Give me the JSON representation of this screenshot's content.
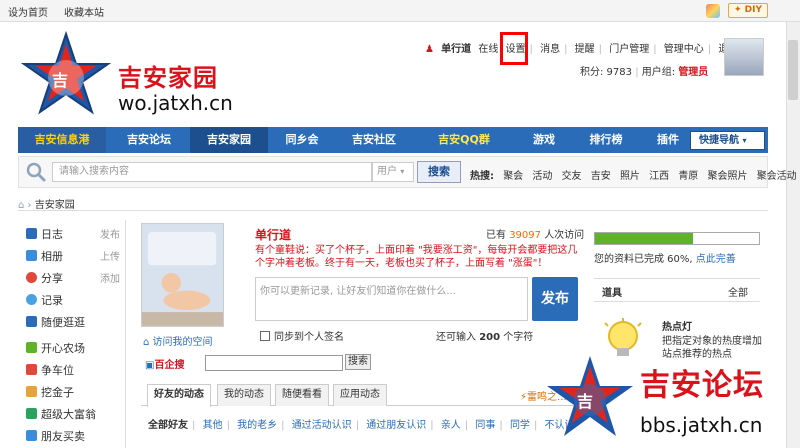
{
  "topbar": {
    "links": [
      "设为首页",
      "收藏本站"
    ],
    "diy_label": "DIY"
  },
  "header": {
    "site_title": "吉安家园",
    "site_url": "wo.jatxh.cn"
  },
  "user_nav": {
    "username": "单行道",
    "status": "在线",
    "links": [
      "设置",
      "消息",
      "提醒",
      "门户管理",
      "管理中心",
      "退出"
    ],
    "points_label": "积分: 9783",
    "group_label": "用户组:",
    "group_value": "管理员"
  },
  "main_nav": {
    "items": [
      "吉安信息港",
      "吉安论坛",
      "吉安家园",
      "同乡会",
      "吉安社区",
      "吉安QQ群",
      "游戏",
      "排行榜",
      "插件"
    ],
    "quick_nav": "快捷导航"
  },
  "search": {
    "placeholder": "请输入搜索内容",
    "type_label": "用户",
    "button": "搜索",
    "hot_label": "热搜:",
    "hot_words": [
      "聚会",
      "活动",
      "交友",
      "吉安",
      "照片",
      "江西",
      "青原",
      "聚会照片",
      "聚会活动"
    ]
  },
  "breadcrumb": {
    "current": "吉安家园"
  },
  "sidebar": {
    "items": [
      {
        "label": "日志",
        "action": "发布",
        "color": "#2b6cb8"
      },
      {
        "label": "相册",
        "action": "上传",
        "color": "#3a8dd8"
      },
      {
        "label": "分享",
        "action": "添加",
        "color": "#e0483c"
      },
      {
        "label": "记录",
        "action": "",
        "color": "#4aa3e0"
      },
      {
        "label": "随便逛逛",
        "action": "",
        "color": "#2b6cb8"
      },
      {
        "label": "开心农场",
        "action": "",
        "color": "#5fb32a"
      },
      {
        "label": "争车位",
        "action": "",
        "color": "#e0483c"
      },
      {
        "label": "挖金子",
        "action": "",
        "color": "#e8a23a"
      },
      {
        "label": "超级大富翁",
        "action": "",
        "color": "#2aa35f"
      },
      {
        "label": "朋友买卖",
        "action": "",
        "color": "#3a8dd8"
      }
    ]
  },
  "profile": {
    "photo_caption": "访问我的空间",
    "name": "单行道",
    "visits_prefix": "已有",
    "visits_count": "39097",
    "visits_suffix": "人次访问",
    "quote": "有个童鞋说：买了个杯子，上面印着 \"我要涨工资\"，每每开会都要把这几个字冲着老板。终于有一天，老板也买了杯子，上面写着 \"涨蛋\"！",
    "status_placeholder": "你可以更新记录, 让好友们知道你在做什么...",
    "publish_button": "发布",
    "sync_label": "同步到个人签名",
    "char_prefix": "还可输入",
    "char_count": "200",
    "char_suffix": "个字符"
  },
  "baiqisou": {
    "logo": "百企搜",
    "button": "搜索"
  },
  "feed": {
    "tabs": [
      "好友的动态",
      "我的动态",
      "随便看看",
      "应用动态"
    ],
    "filters": [
      "全部好友",
      "其他",
      "我的老乡",
      "通过活动认识",
      "通过朋友认识",
      "亲人",
      "同事",
      "同学",
      "不认识"
    ],
    "leiming": "雷鸣之..."
  },
  "right": {
    "progress_value": 0.6,
    "progress_text": "您的资料已完成 60%,",
    "progress_link": "点此完善",
    "tools_title": "道具",
    "tools_all": "全部",
    "hotlamp_title": "热点灯",
    "hotlamp_desc": "把指定对象的热度增加站点推荐的热点"
  },
  "watermark": {
    "title": "吉安论坛",
    "url": "bbs.jatxh.cn"
  }
}
